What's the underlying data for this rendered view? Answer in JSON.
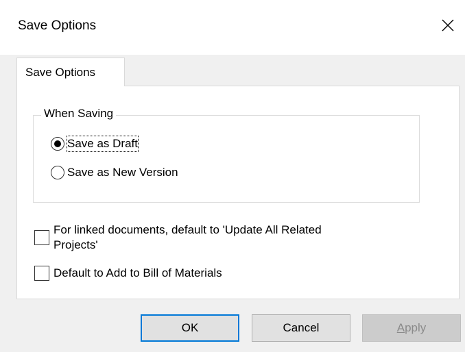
{
  "window": {
    "title": "Save Options",
    "close_icon": "close-x-icon"
  },
  "tabs": [
    {
      "label": "Save Options",
      "selected": true
    }
  ],
  "when_saving": {
    "title": "When Saving",
    "options": [
      {
        "label": "Save as Draft",
        "selected": true
      },
      {
        "label": "Save as New Version",
        "selected": false
      }
    ]
  },
  "checkboxes": {
    "linked_documents": {
      "line1": "For linked documents, default to 'Update All Related",
      "line2": "Projects'",
      "checked": false
    },
    "bill_of_materials": {
      "label": "Default to Add to Bill of Materials",
      "checked": false
    }
  },
  "buttons": {
    "ok": "OK",
    "cancel": "Cancel",
    "apply_first": "A",
    "apply_rest": "pply",
    "apply_enabled": false
  },
  "colors": {
    "accent": "#0078d7",
    "dialog_bg": "#f0f0f0",
    "panel_bg": "#ffffff",
    "disabled_text": "#8a8a8a"
  }
}
